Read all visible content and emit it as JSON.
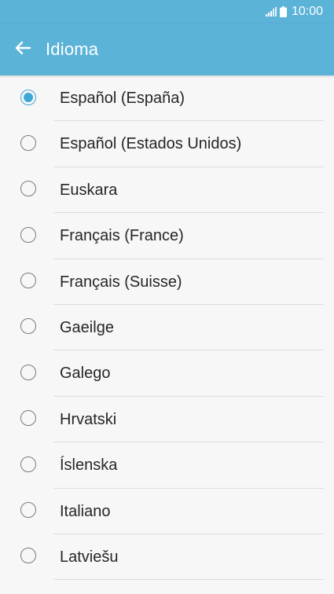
{
  "status_bar": {
    "time": "10:00",
    "icons": [
      "signal-icon",
      "battery-icon"
    ]
  },
  "app_bar": {
    "back_icon": "arrow-left-icon",
    "title": "Idioma"
  },
  "colors": {
    "app_bar": "#5bb3d8",
    "accent": "#3fa7d6",
    "background": "#f7f7f7",
    "text": "#262626",
    "divider": "#dddddd"
  },
  "languages": [
    {
      "label": "Español (España)",
      "selected": true
    },
    {
      "label": "Español (Estados Unidos)",
      "selected": false
    },
    {
      "label": "Euskara",
      "selected": false
    },
    {
      "label": "Français (France)",
      "selected": false
    },
    {
      "label": "Français (Suisse)",
      "selected": false
    },
    {
      "label": "Gaeilge",
      "selected": false
    },
    {
      "label": "Galego",
      "selected": false
    },
    {
      "label": "Hrvatski",
      "selected": false
    },
    {
      "label": "Íslenska",
      "selected": false
    },
    {
      "label": "Italiano",
      "selected": false
    },
    {
      "label": "Latviešu",
      "selected": false
    }
  ]
}
